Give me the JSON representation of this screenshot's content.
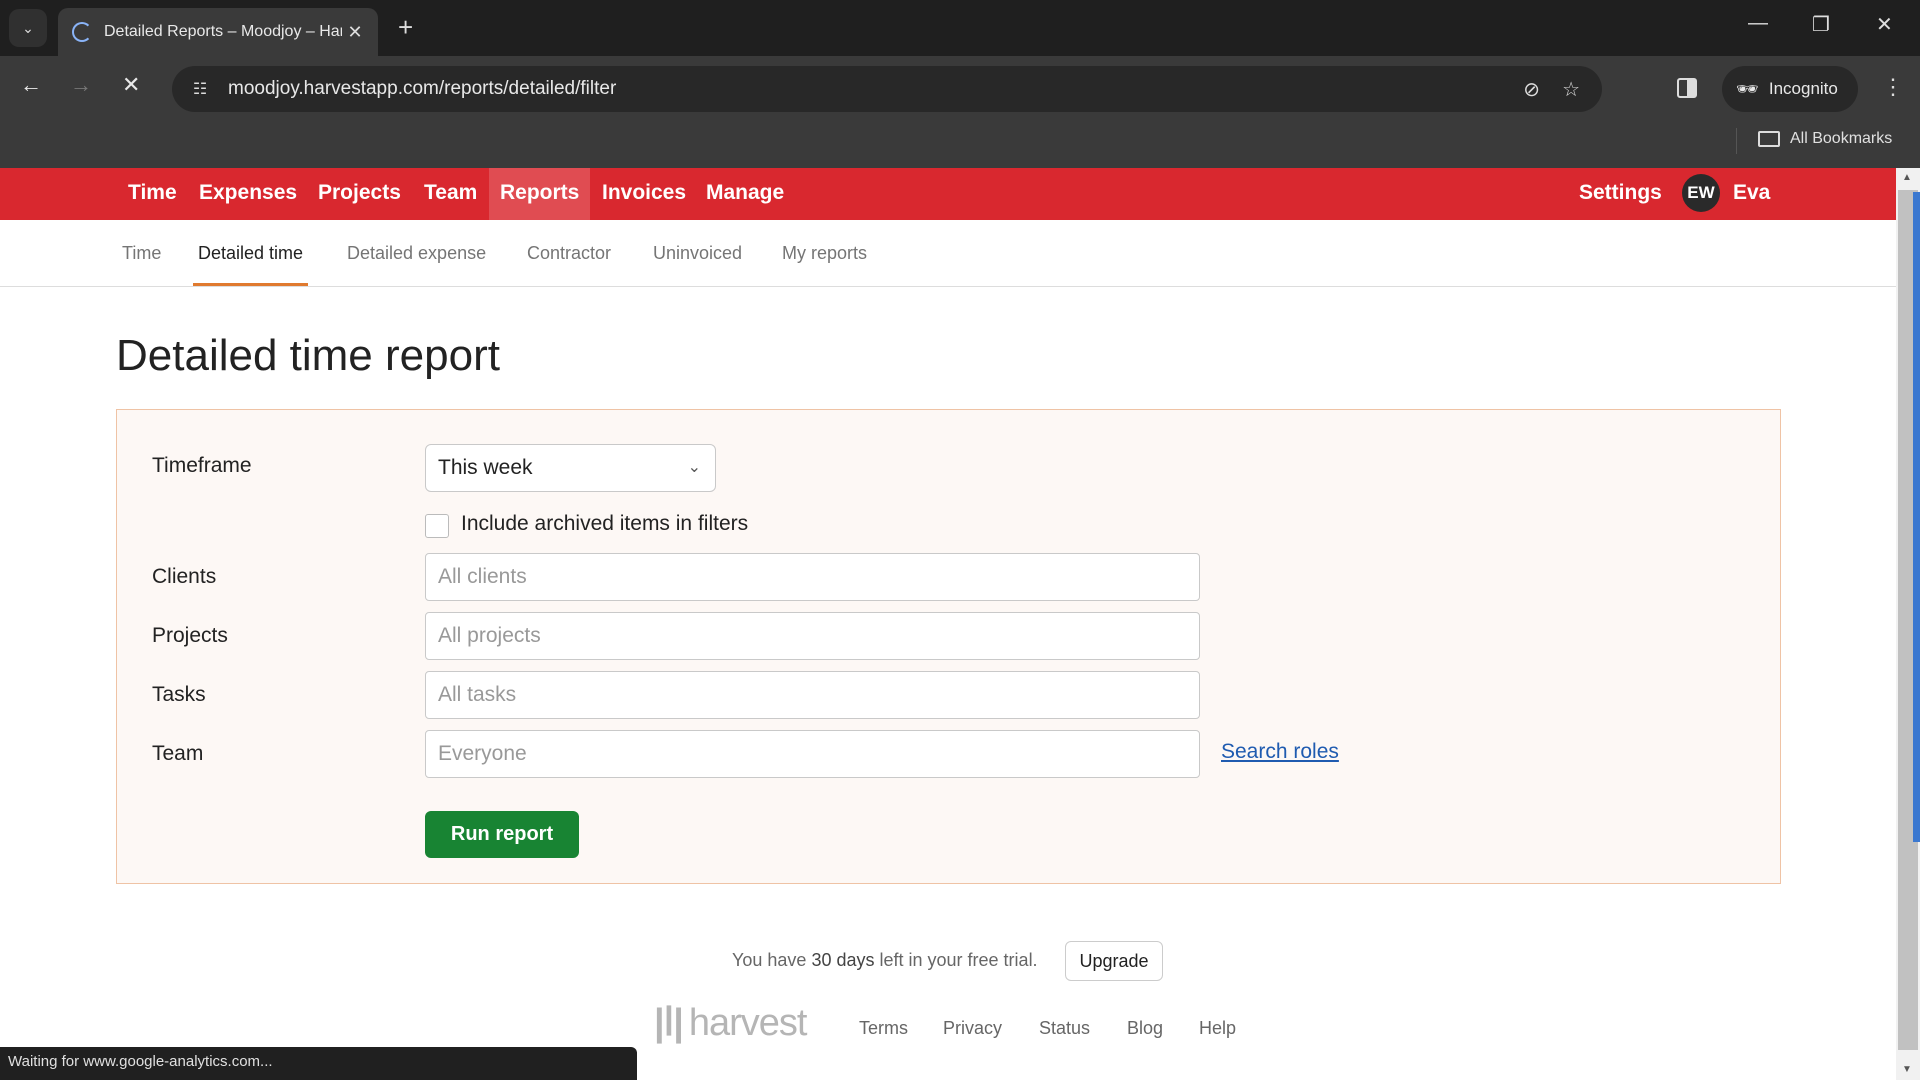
{
  "browser": {
    "tab_title": "Detailed Reports – Moodjoy – Harvest",
    "url": "moodjoy.harvestapp.com/reports/detailed/filter",
    "incognito_label": "Incognito",
    "all_bookmarks_label": "All Bookmarks",
    "status_text": "Waiting for www.google-analytics.com..."
  },
  "topnav": {
    "items": [
      {
        "label": "Time"
      },
      {
        "label": "Expenses"
      },
      {
        "label": "Projects"
      },
      {
        "label": "Team"
      },
      {
        "label": "Reports",
        "active": true
      },
      {
        "label": "Invoices"
      },
      {
        "label": "Manage"
      }
    ],
    "settings_label": "Settings",
    "avatar_initials": "EW",
    "user_name": "Eva",
    "brand_color": "#d9282f"
  },
  "subnav": {
    "items": [
      {
        "label": "Time"
      },
      {
        "label": "Detailed time",
        "active": true
      },
      {
        "label": "Detailed expense"
      },
      {
        "label": "Contractor"
      },
      {
        "label": "Uninvoiced"
      },
      {
        "label": "My reports"
      }
    ]
  },
  "page_title": "Detailed time report",
  "form": {
    "timeframe_label": "Timeframe",
    "timeframe_value": "This week",
    "include_archived_label": "Include archived items in filters",
    "include_archived_checked": false,
    "clients_label": "Clients",
    "clients_placeholder": "All clients",
    "projects_label": "Projects",
    "projects_placeholder": "All projects",
    "tasks_label": "Tasks",
    "tasks_placeholder": "All tasks",
    "team_label": "Team",
    "team_placeholder": "Everyone",
    "search_roles_label": "Search roles",
    "run_report_label": "Run report"
  },
  "footer": {
    "trial_prefix": "You have",
    "trial_days": "30 days",
    "trial_suffix": "left in your free trial.",
    "upgrade_label": "Upgrade",
    "logo_text": "harvest",
    "links": [
      "Terms",
      "Privacy",
      "Status",
      "Blog",
      "Help"
    ]
  }
}
